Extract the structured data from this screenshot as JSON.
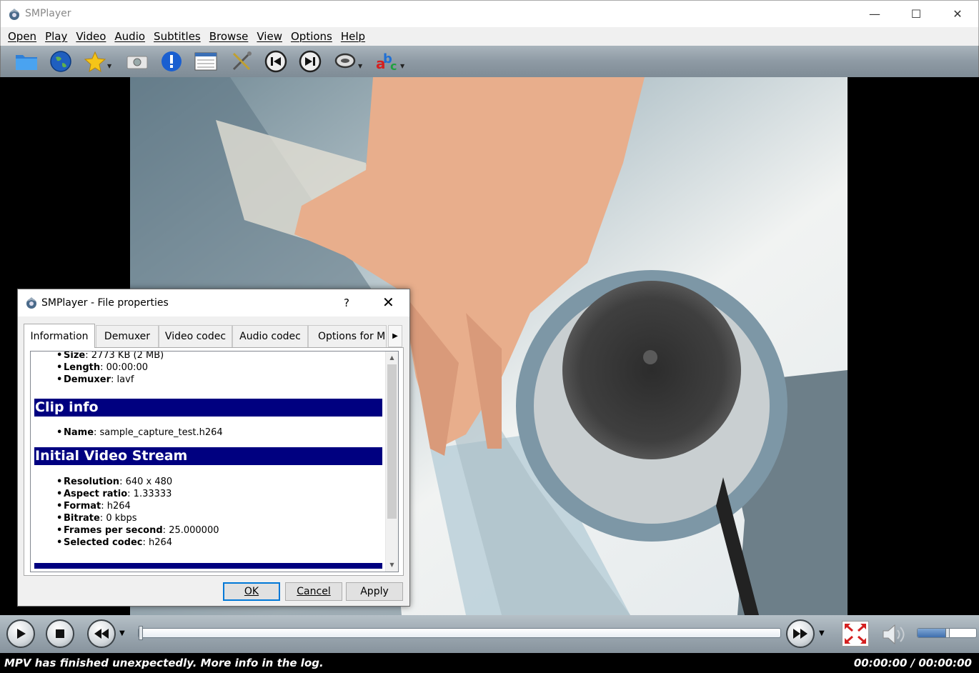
{
  "window": {
    "title": "SMPlayer",
    "minimize_label": "—",
    "maximize_label": "☐",
    "close_label": "✕"
  },
  "menu": [
    "Open",
    "Play",
    "Video",
    "Audio",
    "Subtitles",
    "Browse",
    "View",
    "Options",
    "Help"
  ],
  "toolbar": [
    "open-folder-icon",
    "open-url-globe-icon",
    "favorites-star-icon",
    "screenshot-camera-icon",
    "info-icon",
    "playlist-icon",
    "preferences-tools-icon",
    "previous-icon",
    "next-icon",
    "audio-track-icon",
    "subtitles-abc-icon"
  ],
  "dialog": {
    "title": "SMPlayer - File properties",
    "help_label": "?",
    "close_label": "✕",
    "tabs": [
      "Information",
      "Demuxer",
      "Video codec",
      "Audio codec",
      "Options for MP"
    ],
    "active_tab": "Information",
    "general_items": [
      {
        "key": "Size",
        "value": "2773 KB (2 MB)"
      },
      {
        "key": "Length",
        "value": "00:00:00"
      },
      {
        "key": "Demuxer",
        "value": "lavf"
      }
    ],
    "clip_info": {
      "heading": "Clip info",
      "items": [
        {
          "key": "Name",
          "value": "sample_capture_test.h264"
        }
      ]
    },
    "video_stream": {
      "heading": "Initial Video Stream",
      "items": [
        {
          "key": "Resolution",
          "value": "640 x 480"
        },
        {
          "key": "Aspect ratio",
          "value": "1.33333"
        },
        {
          "key": "Format",
          "value": "h264"
        },
        {
          "key": "Bitrate",
          "value": "0 kbps"
        },
        {
          "key": "Frames per second",
          "value": "25.000000"
        },
        {
          "key": "Selected codec",
          "value": "h264"
        }
      ]
    },
    "buttons": {
      "ok": "OK",
      "cancel": "Cancel",
      "apply": "Apply"
    }
  },
  "controls": {
    "seek_position": 0,
    "volume_level": 0.5
  },
  "status": {
    "message": "MPV has finished unexpectedly. More info in the log.",
    "time": "00:00:00 / 00:00:00"
  }
}
